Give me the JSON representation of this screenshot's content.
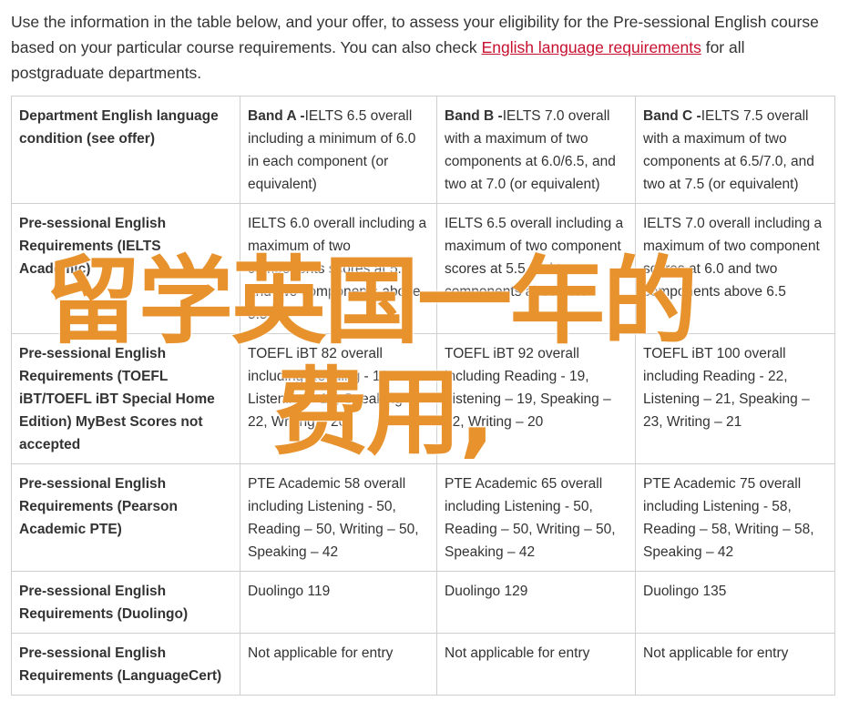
{
  "intro": {
    "text_before_link": "Use the information in the table below, and your offer, to assess your eligibility for the Pre-sessional English course based on your particular course requirements. You can also check ",
    "link_text": "English language requirements",
    "text_after_link": " for all postgraduate departments."
  },
  "table": {
    "header": {
      "first": "Department English language condition (see offer)",
      "bands": [
        {
          "name": "Band A -",
          "detail": "IELTS 6.5 overall including a minimum of 6.0 in each component (or equivalent)"
        },
        {
          "name": "Band B -",
          "detail": "IELTS 7.0 overall with a maximum of two components at 6.0/6.5, and two at 7.0 (or equivalent)"
        },
        {
          "name": "Band C -",
          "detail": "IELTS 7.5 overall with a maximum of two components at 6.5/7.0, and two at 7.5 (or equivalent)"
        }
      ]
    },
    "rows": [
      {
        "label": "Pre-sessional English Requirements (IELTS Academic)",
        "cells": [
          "IELTS 6.0 overall including a maximum of two components scores at 5.5 and two components above 5.5",
          "IELTS 6.5 overall including a maximum of two component scores at 5.5 and two components above 6.0",
          "IELTS 7.0 overall including a maximum of two component scores at 6.0 and two components above 6.5"
        ]
      },
      {
        "label": "Pre-sessional English Requirements (TOEFL iBT/TOEFL iBT Special Home Edition) MyBest Scores not accepted",
        "cells": [
          "TOEFL iBT 82 overall including Reading - 19 Listening – 19, Speaking – 22, Writing – 20",
          "TOEFL iBT 92 overall including Reading - 19, Listening – 19, Speaking – 22, Writing – 20",
          "TOEFL iBT 100 overall including Reading - 22, Listening – 21, Speaking – 23, Writing – 21"
        ]
      },
      {
        "label": "Pre-sessional English Requirements (Pearson Academic PTE)",
        "cells": [
          "PTE Academic 58 overall including Listening - 50, Reading – 50, Writing – 50, Speaking – 42",
          "PTE Academic 65 overall including Listening - 50, Reading – 50, Writing – 50, Speaking – 42",
          "PTE Academic 75 overall including Listening - 58, Reading – 58, Writing – 58, Speaking – 42"
        ]
      },
      {
        "label": "Pre-sessional English Requirements (Duolingo)",
        "cells": [
          "Duolingo 119",
          "Duolingo 129",
          "Duolingo 135"
        ]
      },
      {
        "label": "Pre-sessional English Requirements (LanguageCert)",
        "cells": [
          "Not applicable for entry",
          "Not applicable for entry",
          "Not applicable for entry"
        ]
      }
    ]
  },
  "overlay": {
    "line1": "留学英国一年的",
    "line2": "费用,"
  },
  "colors": {
    "link": "#c8102e",
    "overlay": "#e8922e",
    "border": "#cfcfcf",
    "text": "#333333"
  }
}
